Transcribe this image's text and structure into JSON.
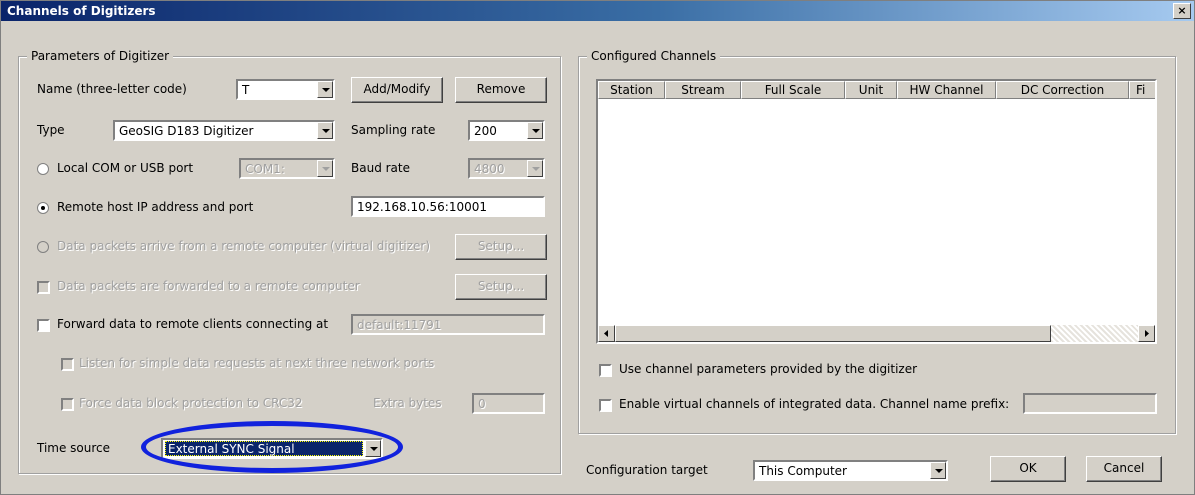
{
  "window": {
    "title": "Channels of Digitizers",
    "close_glyph": "×"
  },
  "params": {
    "group_title": "Parameters of Digitizer",
    "name_label": "Name (three-letter code)",
    "name_value": "T",
    "add_modify": "Add/Modify",
    "remove": "Remove",
    "type_label": "Type",
    "type_value": "GeoSIG D183 Digitizer",
    "sampling_label": "Sampling rate",
    "sampling_value": "200",
    "local_port_label": "Local COM or USB port",
    "com_value": "COM1:",
    "baud_label": "Baud rate",
    "baud_value": "4800",
    "remote_label": "Remote host IP address and port",
    "remote_value": "192.168.10.56:10001",
    "virtual_label": "Data packets arrive from a remote computer (virtual digitizer)",
    "setup1": "Setup...",
    "forwarded_label": "Data packets are forwarded to a remote computer",
    "setup2": "Setup...",
    "forward_clients_label": "Forward data to remote clients connecting at",
    "forward_clients_value": "default:11791",
    "listen_label": "Listen for simple data requests at next three network ports",
    "crc_label": "Force data block protection to CRC32",
    "extra_bytes_label": "Extra bytes",
    "extra_bytes_value": "0",
    "time_source_label": "Time source",
    "time_source_value": "External SYNC Signal"
  },
  "channels": {
    "group_title": "Configured Channels",
    "columns": [
      "Station",
      "Stream",
      "Full Scale",
      "Unit",
      "HW Channel",
      "DC Correction",
      "Fi"
    ],
    "use_params_label": "Use channel parameters provided by the digitizer",
    "virtual_channels_label": "Enable virtual channels of integrated data. Channel name prefix:"
  },
  "footer": {
    "config_target_label": "Configuration target",
    "config_target_value": "This Computer",
    "ok": "OK",
    "cancel": "Cancel"
  },
  "colors": {
    "title_bar": "#0a246a",
    "highlight": "#0a246a",
    "annotation_ellipse": "#1122dd"
  }
}
